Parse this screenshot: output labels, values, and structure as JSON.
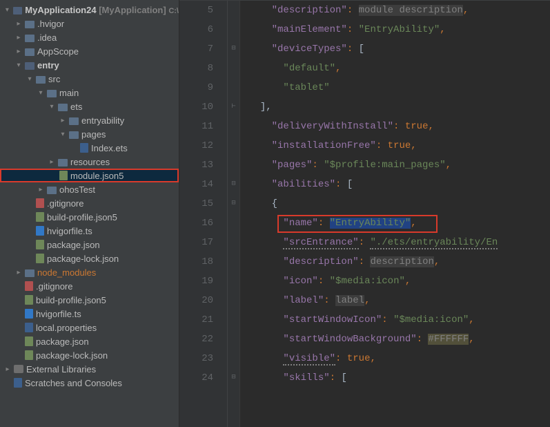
{
  "project": {
    "name": "MyApplication24",
    "context": "[MyApplication]"
  },
  "tree": [
    {
      "depth": 0,
      "arrow": "exp",
      "icon": "folder-entry",
      "label": "",
      "bold": true,
      "special": "root"
    },
    {
      "depth": 1,
      "arrow": "col",
      "icon": "folder",
      "label": ".hvigor"
    },
    {
      "depth": 1,
      "arrow": "col",
      "icon": "folder",
      "label": ".idea"
    },
    {
      "depth": 1,
      "arrow": "col",
      "icon": "folder",
      "label": "AppScope"
    },
    {
      "depth": 1,
      "arrow": "exp",
      "icon": "folder-entry",
      "label": "entry",
      "bold": true
    },
    {
      "depth": 2,
      "arrow": "exp",
      "icon": "folder",
      "label": "src"
    },
    {
      "depth": 3,
      "arrow": "exp",
      "icon": "folder",
      "label": "main"
    },
    {
      "depth": 4,
      "arrow": "exp",
      "icon": "folder",
      "label": "ets"
    },
    {
      "depth": 5,
      "arrow": "col",
      "icon": "folder",
      "label": "entryability"
    },
    {
      "depth": 5,
      "arrow": "exp",
      "icon": "folder",
      "label": "pages"
    },
    {
      "depth": 6,
      "arrow": "",
      "icon": "file",
      "label": "Index.ets"
    },
    {
      "depth": 4,
      "arrow": "col",
      "icon": "folder",
      "label": "resources"
    },
    {
      "depth": 4,
      "arrow": "",
      "icon": "file json",
      "label": "module.json5",
      "selected": true
    },
    {
      "depth": 3,
      "arrow": "col",
      "icon": "folder",
      "label": "ohosTest"
    },
    {
      "depth": 2,
      "arrow": "",
      "icon": "file git",
      "label": ".gitignore"
    },
    {
      "depth": 2,
      "arrow": "",
      "icon": "file json",
      "label": "build-profile.json5"
    },
    {
      "depth": 2,
      "arrow": "",
      "icon": "file ts",
      "label": "hvigorfile.ts"
    },
    {
      "depth": 2,
      "arrow": "",
      "icon": "file json",
      "label": "package.json"
    },
    {
      "depth": 2,
      "arrow": "",
      "icon": "file json",
      "label": "package-lock.json"
    },
    {
      "depth": 1,
      "arrow": "col",
      "icon": "folder orange",
      "label": "node_modules",
      "orange": true
    },
    {
      "depth": 1,
      "arrow": "",
      "icon": "file git",
      "label": ".gitignore"
    },
    {
      "depth": 1,
      "arrow": "",
      "icon": "file json",
      "label": "build-profile.json5"
    },
    {
      "depth": 1,
      "arrow": "",
      "icon": "file ts",
      "label": "hvigorfile.ts"
    },
    {
      "depth": 1,
      "arrow": "",
      "icon": "file",
      "label": "local.properties"
    },
    {
      "depth": 1,
      "arrow": "",
      "icon": "file json",
      "label": "package.json"
    },
    {
      "depth": 1,
      "arrow": "",
      "icon": "file json",
      "label": "package-lock.json"
    },
    {
      "depth": 0,
      "arrow": "col",
      "icon": "lib",
      "label": "External Libraries"
    },
    {
      "depth": 0,
      "arrow": "",
      "icon": "file",
      "label": "Scratches and Consoles"
    }
  ],
  "lines": {
    "5": {
      "k": "description",
      "v": "module description",
      "vcls": "var",
      "comma": true
    },
    "6": {
      "k": "mainElement",
      "v": "\"EntryAbility\"",
      "vcls": "str",
      "comma": true
    },
    "7": {
      "k": "deviceTypes",
      "open": "["
    },
    "8": {
      "plain": "\"default\"",
      "cls": "str",
      "comma": true
    },
    "9": {
      "plain": "\"tablet\"",
      "cls": "str"
    },
    "10": {
      "close": "],"
    },
    "11": {
      "k": "deliveryWithInstall",
      "v": "true",
      "vcls": "kw",
      "comma": true
    },
    "12": {
      "k": "installationFree",
      "v": "true",
      "vcls": "kw",
      "comma": true
    },
    "13": {
      "k": "pages",
      "v": "\"$profile:main_pages\"",
      "vcls": "str",
      "comma": true
    },
    "14": {
      "k": "abilities",
      "open": "["
    },
    "15": {
      "open2": "{"
    },
    "16": {
      "k": "name",
      "v": "\"EntryAbility\"",
      "vcls": "str sel",
      "comma": true,
      "indent2": true,
      "box": true
    },
    "17": {
      "k": "srcEntrance",
      "v": "\"./ets/entryability/En",
      "vcls": "str squiggle",
      "indent2": true,
      "kcls": "squiggle"
    },
    "18": {
      "k": "description",
      "v": "description",
      "vcls": "var",
      "comma": true,
      "indent2": true
    },
    "19": {
      "k": "icon",
      "v": "\"$media:icon\"",
      "vcls": "str",
      "comma": true,
      "indent2": true
    },
    "20": {
      "k": "label",
      "v": "label",
      "vcls": "var",
      "comma": true,
      "indent2": true
    },
    "21": {
      "k": "startWindowIcon",
      "v": "\"$media:icon\"",
      "vcls": "str",
      "comma": true,
      "indent2": true
    },
    "22": {
      "k": "startWindowBackground",
      "v": "#FFFFFF",
      "vcls": "var warnbg",
      "comma": true,
      "indent2": true
    },
    "23": {
      "k": "visible",
      "v": "true",
      "vcls": "kw",
      "comma": true,
      "indent2": true,
      "kcls": "squiggle"
    },
    "24": {
      "k": "skills",
      "open": "[",
      "indent2": true
    }
  },
  "lineStart": 5,
  "lineEnd": 24
}
